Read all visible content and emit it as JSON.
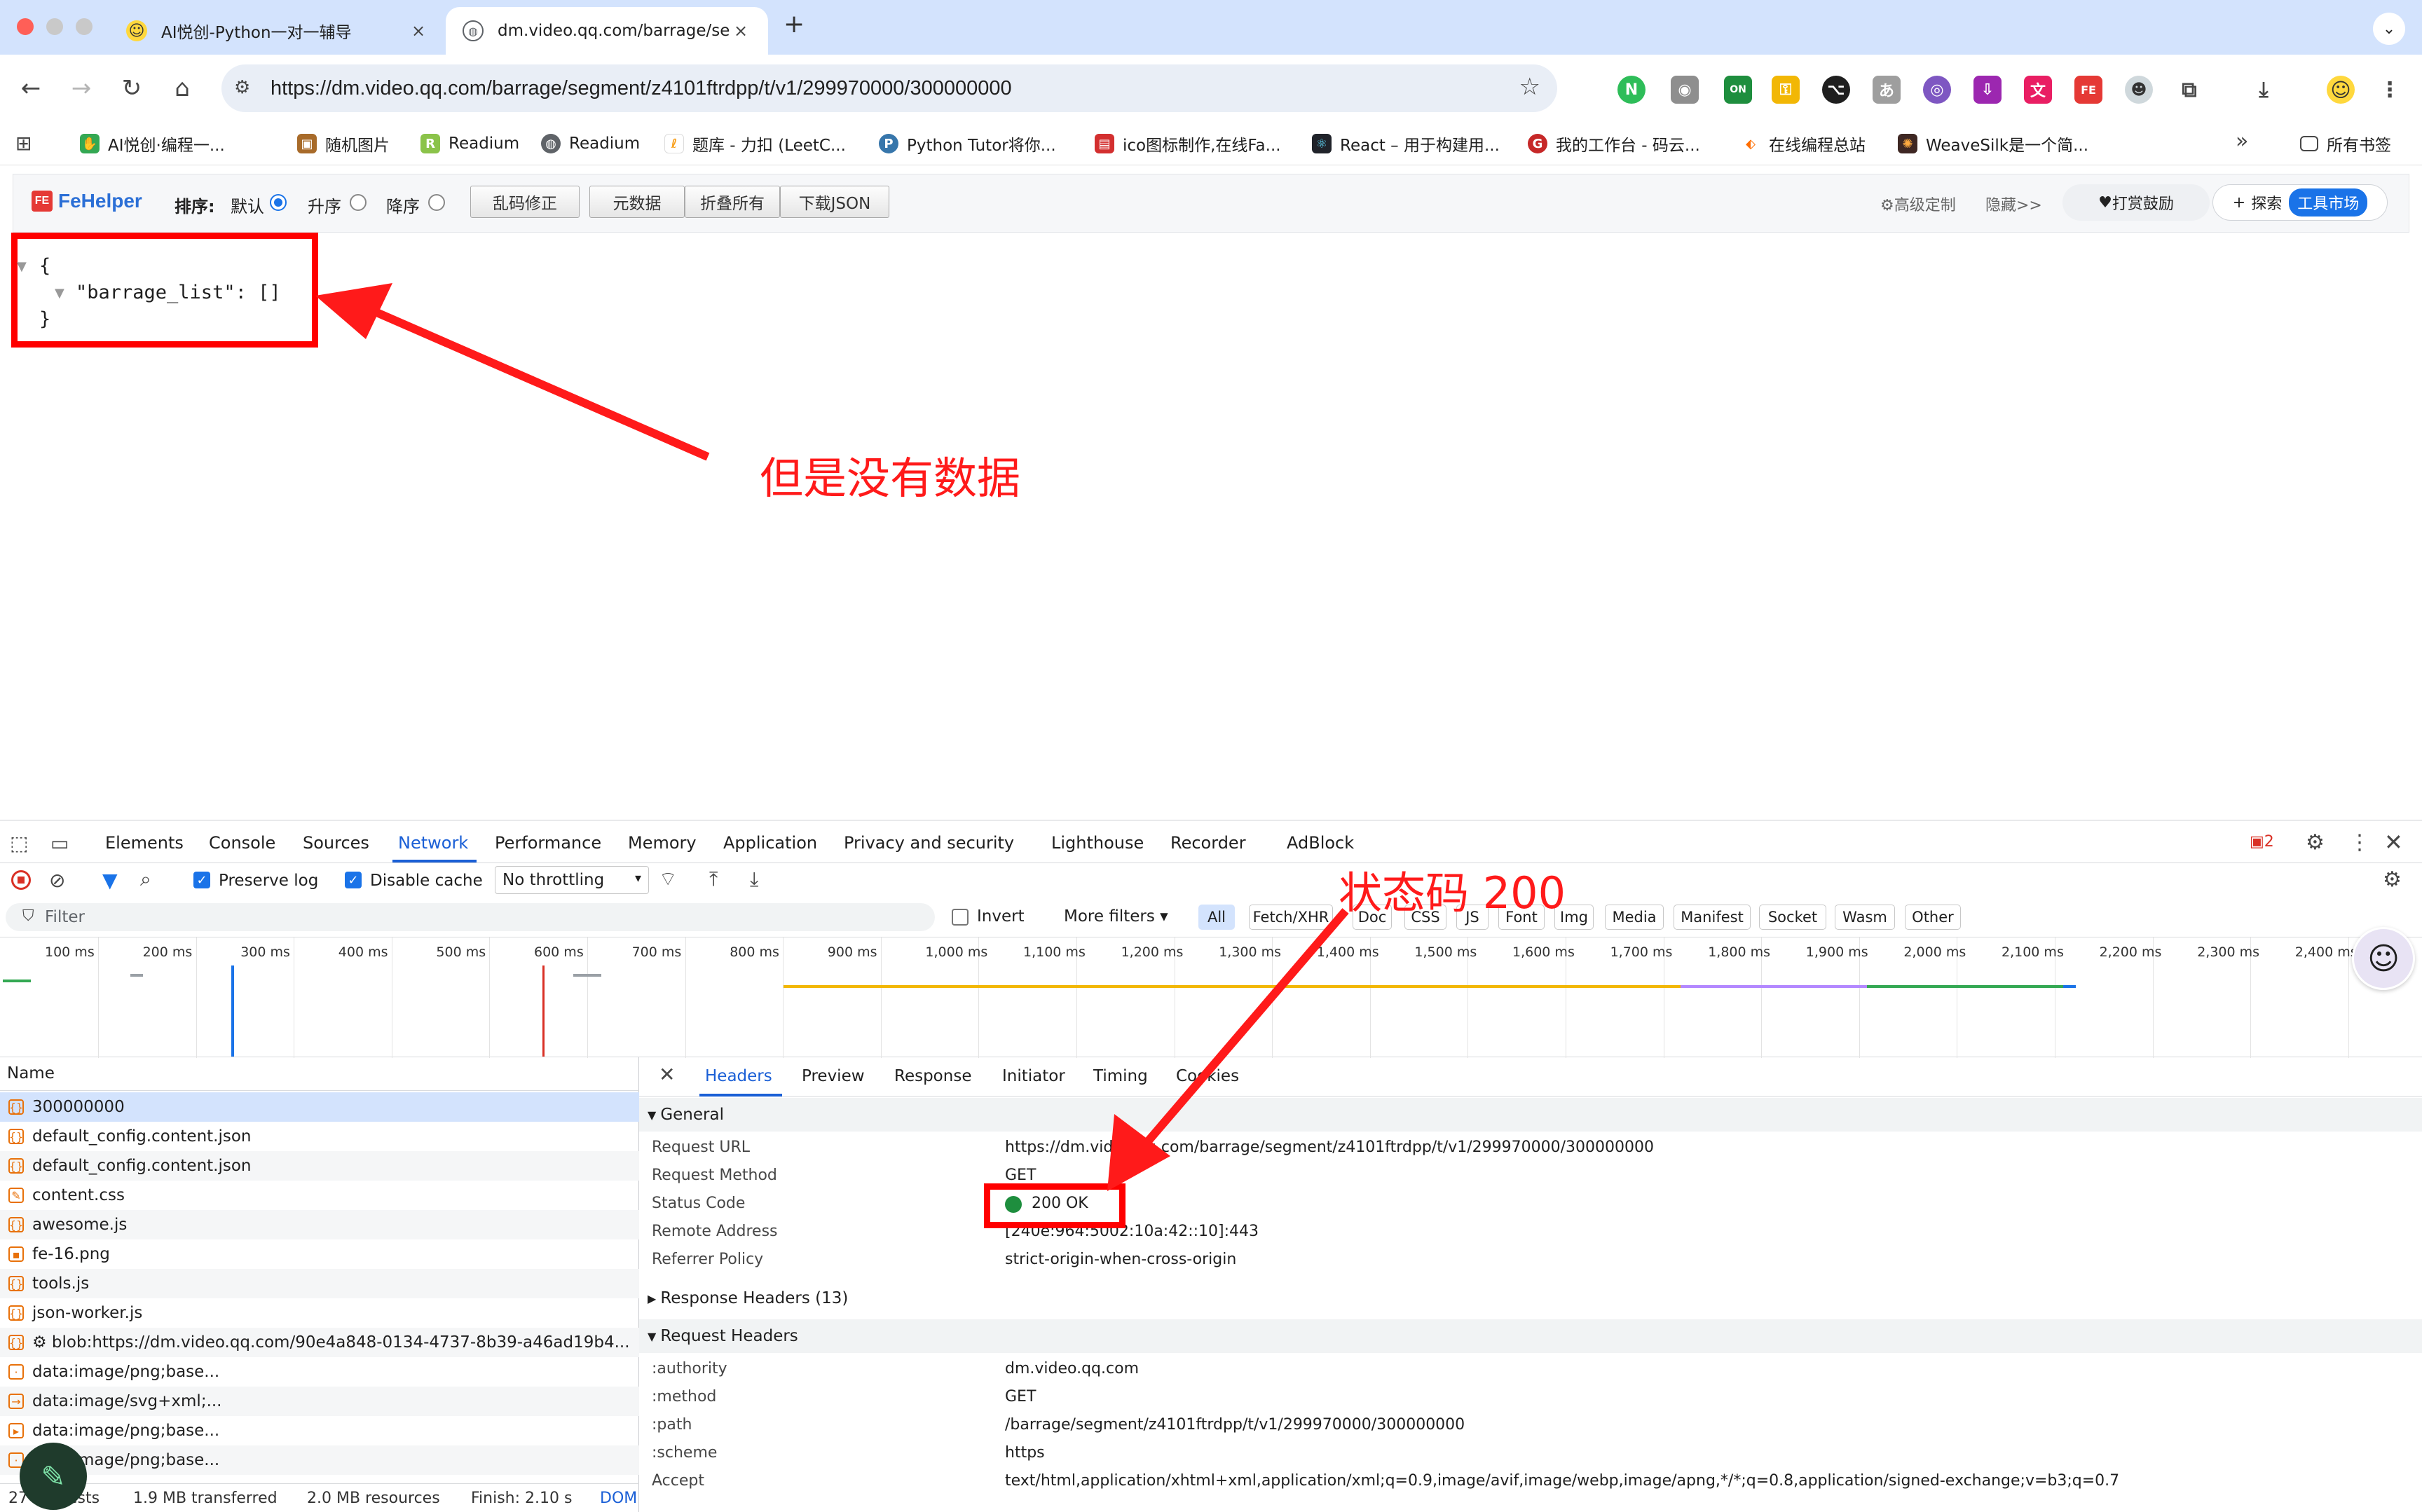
{
  "tabs": [
    {
      "title": "AI悦创-Python一对一辅导",
      "close": "×"
    },
    {
      "title": "dm.video.qq.com/barrage/se",
      "close": "×"
    }
  ],
  "new_tab": "+",
  "address": {
    "url": "https://dm.video.qq.com/barrage/segment/z4101ftrdpp/t/v1/299970000/300000000"
  },
  "bookmarks": {
    "items": [
      "AI悦创·编程一...",
      "随机图片",
      "Readium",
      "Readium",
      "题库 - 力扣 (LeetC...",
      "Python Tutor将你...",
      "ico图标制作,在线Fa...",
      "React – 用于构建用...",
      "我的工作台 - 码云...",
      "在线编程总站",
      "WeaveSilk是一个简..."
    ],
    "more": "»",
    "all": "所有书签"
  },
  "fehelper": {
    "logo": "FeHelper",
    "logo_mark": "FE",
    "sort_label": "排序:",
    "opt_default": "默认",
    "opt_asc": "升序",
    "opt_desc": "降序",
    "btn_fix": "乱码修正",
    "btn_meta": "元数据",
    "btn_fold": "折叠所有",
    "btn_download": "下载JSON",
    "advanced": "高级定制",
    "hide": "隐藏>>",
    "donate": "打赏鼓励",
    "explore": "探索",
    "market": "工具市场"
  },
  "json_view": {
    "open": "{",
    "key_line": "\"barrage_list\": []",
    "close": "}"
  },
  "annotations": {
    "no_data": "但是没有数据",
    "status_code": "状态码 200",
    "color": "#ff1a1a"
  },
  "devtools": {
    "tabs": [
      "Elements",
      "Console",
      "Sources",
      "Network",
      "Performance",
      "Memory",
      "Application",
      "Privacy and security",
      "Lighthouse",
      "Recorder",
      "AdBlock"
    ],
    "error_count": "2",
    "preserve_log": "Preserve log",
    "disable_cache": "Disable cache",
    "throttling": "No throttling",
    "filter_placeholder": "Filter",
    "invert": "Invert",
    "more_filters": "More filters",
    "chips": [
      "All",
      "Fetch/XHR",
      "Doc",
      "CSS",
      "JS",
      "Font",
      "Img",
      "Media",
      "Manifest",
      "Socket",
      "Wasm",
      "Other"
    ],
    "timeline_ticks": [
      "100 ms",
      "200 ms",
      "300 ms",
      "400 ms",
      "500 ms",
      "600 ms",
      "700 ms",
      "800 ms",
      "900 ms",
      "1,000 ms",
      "1,100 ms",
      "1,200 ms",
      "1,300 ms",
      "1,400 ms",
      "1,500 ms",
      "1,600 ms",
      "1,700 ms",
      "1,800 ms",
      "1,900 ms",
      "2,000 ms",
      "2,100 ms",
      "2,200 ms",
      "2,300 ms",
      "2,400 ms"
    ],
    "name_header": "Name",
    "requests": [
      {
        "name": "300000000",
        "icon": "{}"
      },
      {
        "name": "default_config.content.json",
        "icon": "{}"
      },
      {
        "name": "default_config.content.json",
        "icon": "{}"
      },
      {
        "name": "content.css",
        "icon": "✎"
      },
      {
        "name": "awesome.js",
        "icon": "{}"
      },
      {
        "name": "fe-16.png",
        "icon": "▪"
      },
      {
        "name": "tools.js",
        "icon": "{}"
      },
      {
        "name": "json-worker.js",
        "icon": "{}"
      },
      {
        "name": "⚙ blob:https://dm.video.qq.com/90e4a848-0134-4737-8b39-a46ad19b4...",
        "icon": "{}"
      },
      {
        "name": "data:image/png;base...",
        "icon": "·"
      },
      {
        "name": "data:image/svg+xml;...",
        "icon": "→"
      },
      {
        "name": "data:image/png;base...",
        "icon": "▸"
      },
      {
        "name": "data:image/png;base...",
        "icon": "·"
      }
    ],
    "summary": {
      "requests": "27 requests",
      "transferred": "1.9 MB transferred",
      "resources": "2.0 MB resources",
      "finish": "Finish: 2.10 s",
      "dom": "DOM"
    },
    "detail_tabs": [
      "Headers",
      "Preview",
      "Response",
      "Initiator",
      "Timing",
      "Cookies"
    ],
    "general_title": "General",
    "general": [
      {
        "k": "Request URL",
        "v": "https://dm.video.qq.com/barrage/segment/z4101ftrdpp/t/v1/299970000/300000000"
      },
      {
        "k": "Request Method",
        "v": "GET"
      },
      {
        "k": "Status Code",
        "v": "200 OK"
      },
      {
        "k": "Remote Address",
        "v": "[240e:964:5002:10a:42::10]:443"
      },
      {
        "k": "Referrer Policy",
        "v": "strict-origin-when-cross-origin"
      }
    ],
    "response_headers_title": "Response Headers (13)",
    "request_headers_title": "Request Headers",
    "request_headers": [
      {
        "k": ":authority",
        "v": "dm.video.qq.com"
      },
      {
        "k": ":method",
        "v": "GET"
      },
      {
        "k": ":path",
        "v": "/barrage/segment/z4101ftrdpp/t/v1/299970000/300000000"
      },
      {
        "k": ":scheme",
        "v": "https"
      },
      {
        "k": "Accept",
        "v": "text/html,application/xhtml+xml,application/xml;q=0.9,image/avif,image/webp,image/apng,*/*;q=0.8,application/signed-exchange;v=b3;q=0.7"
      }
    ]
  }
}
